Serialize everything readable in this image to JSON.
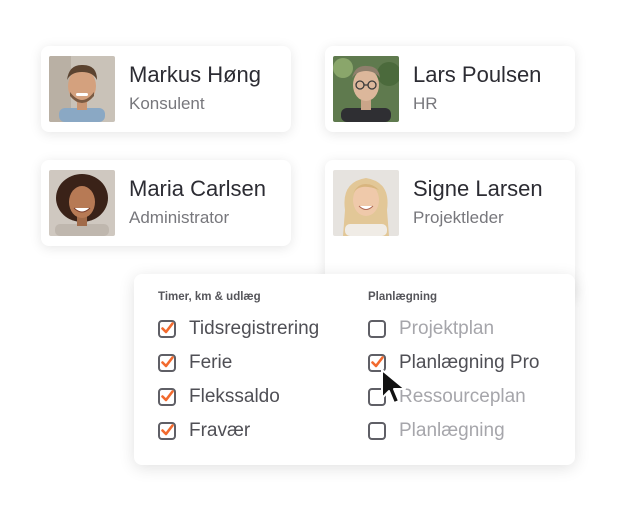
{
  "people": [
    {
      "name": "Markus Høng",
      "role": "Konsulent"
    },
    {
      "name": "Lars Poulsen",
      "role": "HR"
    },
    {
      "name": "Maria Carlsen",
      "role": "Administrator"
    },
    {
      "name": "Signe Larsen",
      "role": "Projektleder"
    }
  ],
  "permissions": {
    "left_title": "Timer, km & udlæg",
    "right_title": "Planlægning",
    "left_items": [
      {
        "label": "Tidsregistrering",
        "checked": true
      },
      {
        "label": "Ferie",
        "checked": true
      },
      {
        "label": "Flekssaldo",
        "checked": true
      },
      {
        "label": "Fravær",
        "checked": true
      }
    ],
    "right_items": [
      {
        "label": "Projektplan",
        "checked": false
      },
      {
        "label": "Planlægning Pro",
        "checked": true
      },
      {
        "label": "Ressourceplan",
        "checked": false
      },
      {
        "label": "Planlægning",
        "checked": false
      }
    ]
  },
  "colors": {
    "accent": "#f26a2e",
    "checkbox_border": "#5f5f66"
  },
  "icons": {
    "pointer": "cursor-arrow-icon",
    "check": "checkmark-icon"
  }
}
